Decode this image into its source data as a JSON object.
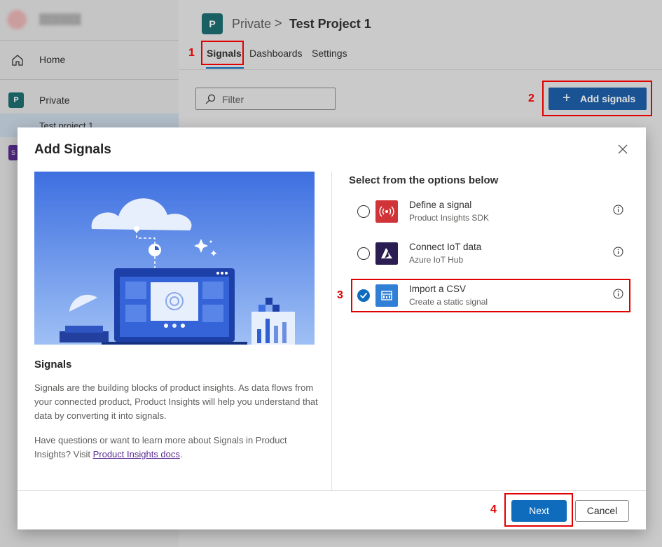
{
  "sidebar": {
    "home_label": "Home",
    "private_badge": "P",
    "private_label": "Private",
    "project_label": "Test project 1",
    "second_badge": "S"
  },
  "header": {
    "project_badge": "P",
    "breadcrumb_root": "Private",
    "breadcrumb_sep": ">",
    "breadcrumb_current": "Test Project 1"
  },
  "tabs": [
    {
      "label": "Signals",
      "active": true
    },
    {
      "label": "Dashboards",
      "active": false
    },
    {
      "label": "Settings",
      "active": false
    }
  ],
  "toolbar": {
    "filter_placeholder": "Filter",
    "add_plus": "+",
    "add_label": "Add signals"
  },
  "callouts": [
    "1",
    "2",
    "3",
    "4"
  ],
  "dialog": {
    "title": "Add Signals",
    "left_heading": "Signals",
    "left_para1": "Signals are the building blocks of product insights. As data flows from your connected product, Product Insights will help you understand that data by converting it into signals.",
    "left_para2_prefix": "Have questions or want to learn more about Signals in Product Insights? Visit ",
    "left_para2_link": "Product Insights docs",
    "left_para2_suffix": ".",
    "right_heading": "Select from the options below",
    "options": [
      {
        "title": "Define a signal",
        "subtitle": "Product Insights SDK",
        "selected": false,
        "icon": "broadcast-icon",
        "icon_color": "#d13438"
      },
      {
        "title": "Connect IoT data",
        "subtitle": "Azure IoT Hub",
        "selected": false,
        "icon": "azure-icon",
        "icon_color": "#2b1d52"
      },
      {
        "title": "Import a CSV",
        "subtitle": "Create a static signal",
        "selected": true,
        "icon": "csv-icon",
        "icon_color": "#2f7fd6"
      }
    ],
    "next_label": "Next",
    "cancel_label": "Cancel"
  },
  "colors": {
    "accent": "#0f6cbd",
    "callout": "#e00000",
    "brand_teal": "#1e6e70"
  }
}
